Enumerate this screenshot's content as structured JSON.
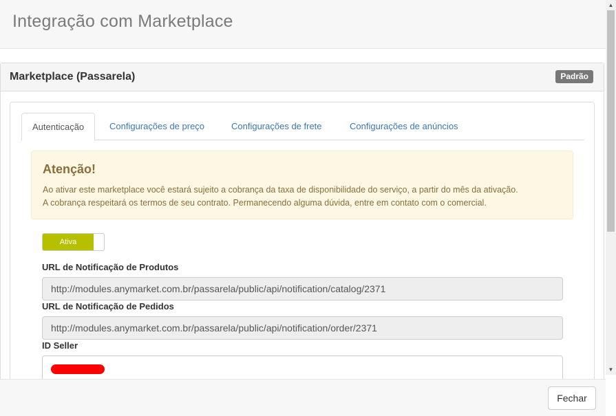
{
  "modal": {
    "title": "Integração com Marketplace"
  },
  "panel": {
    "title": "Marketplace (Passarela)",
    "badge": "Padrão"
  },
  "tabs": [
    {
      "label": "Autenticação",
      "active": true
    },
    {
      "label": "Configurações de preço",
      "active": false
    },
    {
      "label": "Configurações de frete",
      "active": false
    },
    {
      "label": "Configurações de anúncios",
      "active": false
    }
  ],
  "alert": {
    "title": "Atenção!",
    "line1": "Ao ativar este marketplace você estará sujeito a cobrança da taxa de disponibilidade do serviço, a partir do mês da ativação.",
    "line2": "A cobrança respeitará os termos de seu contrato. Permanecendo alguma dúvida, entre em contato com o comercial."
  },
  "toggle": {
    "label": "Ativa",
    "state": "on",
    "color": "#b5c000"
  },
  "fields": {
    "products_url": {
      "label": "URL de Notificação de Produtos",
      "value": "http://modules.anymarket.com.br/passarela/public/api/notification/catalog/2371"
    },
    "orders_url": {
      "label": "URL de Notificação de Pedidos",
      "value": "http://modules.anymarket.com.br/passarela/public/api/notification/order/2371"
    },
    "seller_id": {
      "label": "ID Seller",
      "value": ""
    }
  },
  "footer": {
    "close_label": "Fechar"
  },
  "colors": {
    "link": "#3c78b4",
    "alert_text": "#8a6d3b",
    "alert_bg": "#fcf8e3",
    "badge_bg": "#777777",
    "redaction": "#ff0000"
  }
}
